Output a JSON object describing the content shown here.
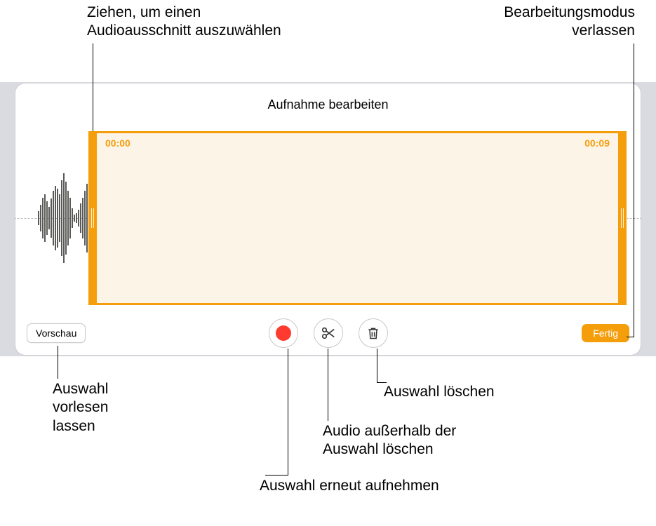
{
  "panel": {
    "title": "Aufnahme bearbeiten",
    "time_start": "00:00",
    "time_end": "00:09",
    "preview_label": "Vorschau",
    "done_label": "Fertig"
  },
  "callouts": {
    "drag_select": "Ziehen, um einen\nAudioausschnitt auszuwählen",
    "exit_edit": "Bearbeitungsmodus\nverlassen",
    "preview_desc": "Auswahl\nvorlesen\nlassen",
    "record_desc": "Auswahl erneut aufnehmen",
    "trim_desc": "Audio außerhalb der\nAuswahl löschen",
    "delete_desc": "Auswahl löschen"
  },
  "icons": {
    "record": "record-icon",
    "scissors": "scissors-icon",
    "trash": "trash-icon"
  },
  "colors": {
    "accent": "#f59e0b",
    "record": "#ff3b30"
  }
}
